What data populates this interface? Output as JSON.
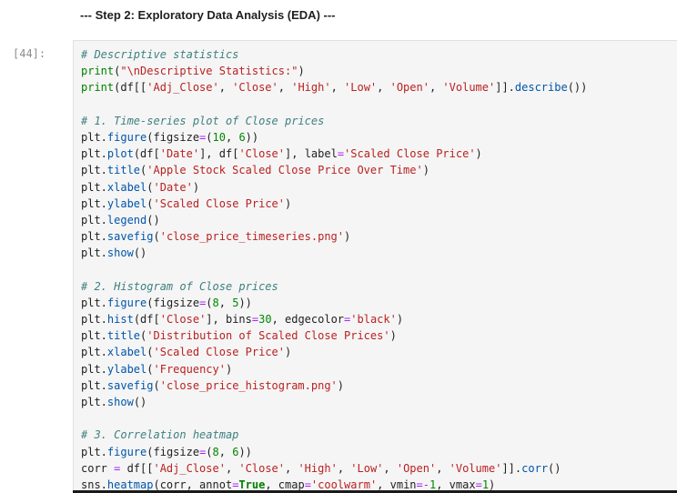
{
  "markdown_cell": {
    "text": "--- Step 2: Exploratory Data Analysis (EDA) ---"
  },
  "code_cell": {
    "prompt": "[44]:",
    "lines": [
      [
        [
          "comment",
          "# Descriptive statistics"
        ]
      ],
      [
        [
          "builtin",
          "print"
        ],
        [
          "plain",
          "("
        ],
        [
          "string",
          "\"\\nDescriptive Statistics:\""
        ],
        [
          "plain",
          ")"
        ]
      ],
      [
        [
          "builtin",
          "print"
        ],
        [
          "plain",
          "(df[["
        ],
        [
          "string",
          "'Adj_Close'"
        ],
        [
          "plain",
          ", "
        ],
        [
          "string",
          "'Close'"
        ],
        [
          "plain",
          ", "
        ],
        [
          "string",
          "'High'"
        ],
        [
          "plain",
          ", "
        ],
        [
          "string",
          "'Low'"
        ],
        [
          "plain",
          ", "
        ],
        [
          "string",
          "'Open'"
        ],
        [
          "plain",
          ", "
        ],
        [
          "string",
          "'Volume'"
        ],
        [
          "plain",
          "]]."
        ],
        [
          "attr",
          "describe"
        ],
        [
          "plain",
          "())"
        ]
      ],
      [],
      [
        [
          "comment",
          "# 1. Time-series plot of Close prices"
        ]
      ],
      [
        [
          "plain",
          "plt."
        ],
        [
          "attr",
          "figure"
        ],
        [
          "plain",
          "(figsize"
        ],
        [
          "op",
          "="
        ],
        [
          "plain",
          "("
        ],
        [
          "number",
          "10"
        ],
        [
          "plain",
          ", "
        ],
        [
          "number",
          "6"
        ],
        [
          "plain",
          "))"
        ]
      ],
      [
        [
          "plain",
          "plt."
        ],
        [
          "attr",
          "plot"
        ],
        [
          "plain",
          "(df["
        ],
        [
          "string",
          "'Date'"
        ],
        [
          "plain",
          "], df["
        ],
        [
          "string",
          "'Close'"
        ],
        [
          "plain",
          "], label"
        ],
        [
          "op",
          "="
        ],
        [
          "string",
          "'Scaled Close Price'"
        ],
        [
          "plain",
          ")"
        ]
      ],
      [
        [
          "plain",
          "plt."
        ],
        [
          "attr",
          "title"
        ],
        [
          "plain",
          "("
        ],
        [
          "string",
          "'Apple Stock Scaled Close Price Over Time'"
        ],
        [
          "plain",
          ")"
        ]
      ],
      [
        [
          "plain",
          "plt."
        ],
        [
          "attr",
          "xlabel"
        ],
        [
          "plain",
          "("
        ],
        [
          "string",
          "'Date'"
        ],
        [
          "plain",
          ")"
        ]
      ],
      [
        [
          "plain",
          "plt."
        ],
        [
          "attr",
          "ylabel"
        ],
        [
          "plain",
          "("
        ],
        [
          "string",
          "'Scaled Close Price'"
        ],
        [
          "plain",
          ")"
        ]
      ],
      [
        [
          "plain",
          "plt."
        ],
        [
          "attr",
          "legend"
        ],
        [
          "plain",
          "()"
        ]
      ],
      [
        [
          "plain",
          "plt."
        ],
        [
          "attr",
          "savefig"
        ],
        [
          "plain",
          "("
        ],
        [
          "string",
          "'close_price_timeseries.png'"
        ],
        [
          "plain",
          ")"
        ]
      ],
      [
        [
          "plain",
          "plt."
        ],
        [
          "attr",
          "show"
        ],
        [
          "plain",
          "()"
        ]
      ],
      [],
      [
        [
          "comment",
          "# 2. Histogram of Close prices"
        ]
      ],
      [
        [
          "plain",
          "plt."
        ],
        [
          "attr",
          "figure"
        ],
        [
          "plain",
          "(figsize"
        ],
        [
          "op",
          "="
        ],
        [
          "plain",
          "("
        ],
        [
          "number",
          "8"
        ],
        [
          "plain",
          ", "
        ],
        [
          "number",
          "5"
        ],
        [
          "plain",
          "))"
        ]
      ],
      [
        [
          "plain",
          "plt."
        ],
        [
          "attr",
          "hist"
        ],
        [
          "plain",
          "(df["
        ],
        [
          "string",
          "'Close'"
        ],
        [
          "plain",
          "], bins"
        ],
        [
          "op",
          "="
        ],
        [
          "number",
          "30"
        ],
        [
          "plain",
          ", edgecolor"
        ],
        [
          "op",
          "="
        ],
        [
          "string",
          "'black'"
        ],
        [
          "plain",
          ")"
        ]
      ],
      [
        [
          "plain",
          "plt."
        ],
        [
          "attr",
          "title"
        ],
        [
          "plain",
          "("
        ],
        [
          "string",
          "'Distribution of Scaled Close Prices'"
        ],
        [
          "plain",
          ")"
        ]
      ],
      [
        [
          "plain",
          "plt."
        ],
        [
          "attr",
          "xlabel"
        ],
        [
          "plain",
          "("
        ],
        [
          "string",
          "'Scaled Close Price'"
        ],
        [
          "plain",
          ")"
        ]
      ],
      [
        [
          "plain",
          "plt."
        ],
        [
          "attr",
          "ylabel"
        ],
        [
          "plain",
          "("
        ],
        [
          "string",
          "'Frequency'"
        ],
        [
          "plain",
          ")"
        ]
      ],
      [
        [
          "plain",
          "plt."
        ],
        [
          "attr",
          "savefig"
        ],
        [
          "plain",
          "("
        ],
        [
          "string",
          "'close_price_histogram.png'"
        ],
        [
          "plain",
          ")"
        ]
      ],
      [
        [
          "plain",
          "plt."
        ],
        [
          "attr",
          "show"
        ],
        [
          "plain",
          "()"
        ]
      ],
      [],
      [
        [
          "comment",
          "# 3. Correlation heatmap"
        ]
      ],
      [
        [
          "plain",
          "plt."
        ],
        [
          "attr",
          "figure"
        ],
        [
          "plain",
          "(figsize"
        ],
        [
          "op",
          "="
        ],
        [
          "plain",
          "("
        ],
        [
          "number",
          "8"
        ],
        [
          "plain",
          ", "
        ],
        [
          "number",
          "6"
        ],
        [
          "plain",
          "))"
        ]
      ],
      [
        [
          "plain",
          "corr "
        ],
        [
          "op",
          "="
        ],
        [
          "plain",
          " df[["
        ],
        [
          "string",
          "'Adj_Close'"
        ],
        [
          "plain",
          ", "
        ],
        [
          "string",
          "'Close'"
        ],
        [
          "plain",
          ", "
        ],
        [
          "string",
          "'High'"
        ],
        [
          "plain",
          ", "
        ],
        [
          "string",
          "'Low'"
        ],
        [
          "plain",
          ", "
        ],
        [
          "string",
          "'Open'"
        ],
        [
          "plain",
          ", "
        ],
        [
          "string",
          "'Volume'"
        ],
        [
          "plain",
          "]]."
        ],
        [
          "attr",
          "corr"
        ],
        [
          "plain",
          "()"
        ]
      ],
      [
        [
          "plain",
          "sns."
        ],
        [
          "attr",
          "heatmap"
        ],
        [
          "plain",
          "(corr, annot"
        ],
        [
          "op",
          "="
        ],
        [
          "kw",
          "True"
        ],
        [
          "plain",
          ", cmap"
        ],
        [
          "op",
          "="
        ],
        [
          "string",
          "'coolwarm'"
        ],
        [
          "plain",
          ", vmin"
        ],
        [
          "op",
          "=-"
        ],
        [
          "number",
          "1"
        ],
        [
          "plain",
          ", vmax"
        ],
        [
          "op",
          "="
        ],
        [
          "number",
          "1"
        ],
        [
          "plain",
          ")"
        ]
      ]
    ]
  }
}
